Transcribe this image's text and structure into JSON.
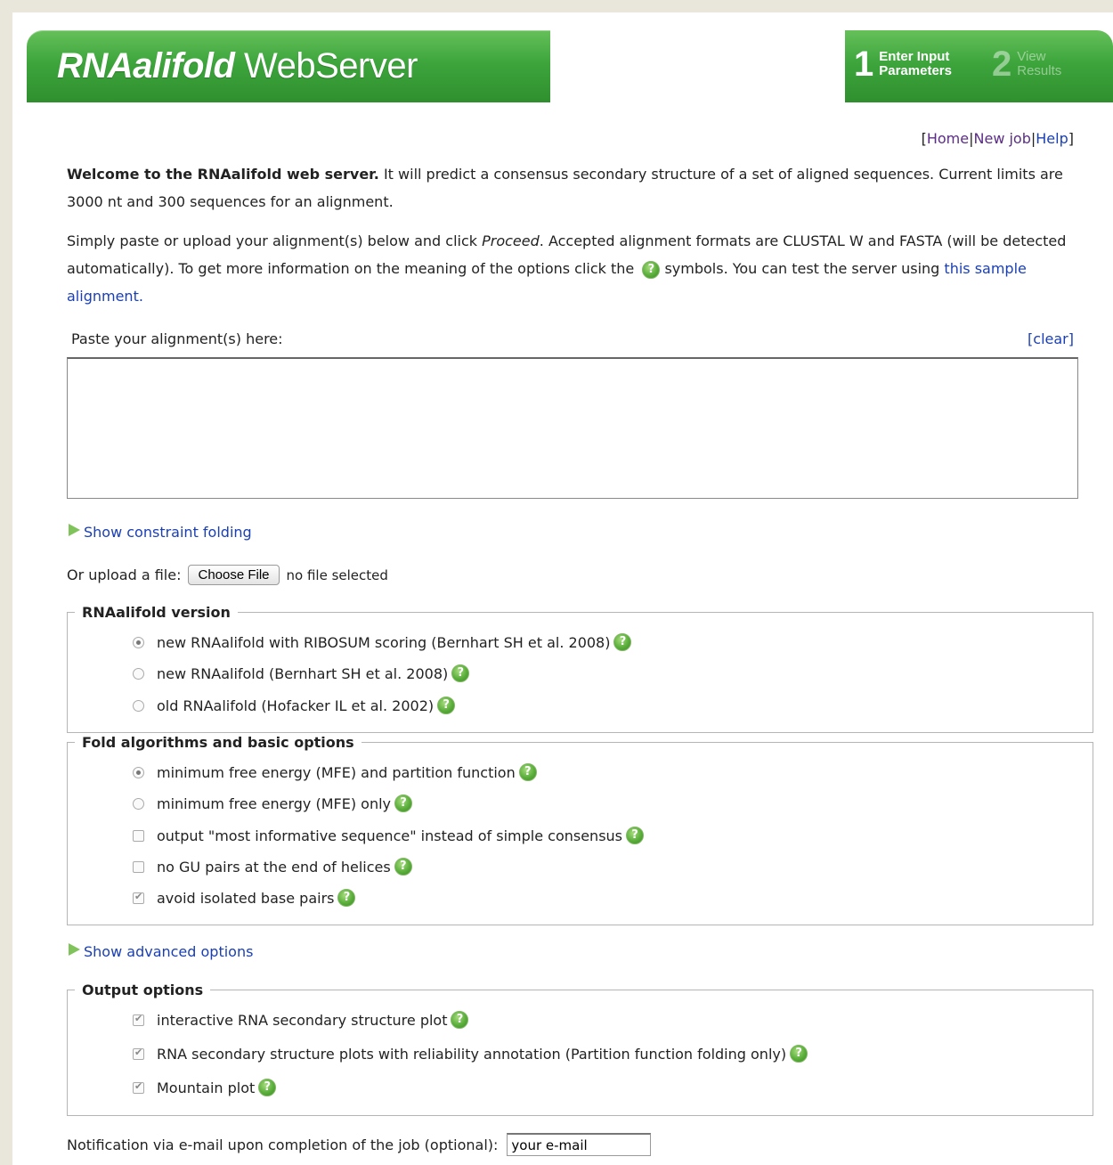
{
  "header": {
    "title_bold": "RNAalifold",
    "title_rest": " WebServer",
    "steps": [
      {
        "num": "1",
        "line1": "Enter Input",
        "line2": "Parameters"
      },
      {
        "num": "2",
        "line1": "View",
        "line2": "Results"
      }
    ]
  },
  "nav": {
    "open": "[",
    "home": "Home",
    "sep1": "|",
    "newjob": "New job",
    "sep2": "|",
    "help": "Help",
    "close": "]"
  },
  "intro": {
    "bold": "Welcome to the RNAalifold web server.",
    "text": " It will predict a consensus secondary structure of a set of aligned sequences. Current limits are 3000 nt and 300 sequences for an alignment."
  },
  "instructions": {
    "part1": "Simply paste or upload your alignment(s) below and click ",
    "proceed": "Proceed",
    "part2": ". Accepted alignment formats are CLUSTAL W and FASTA (will be detected automatically). To get more information on the meaning of the options click the ",
    "part3": " symbols. You can test the server using ",
    "sample_link": "this sample alignment."
  },
  "alignment": {
    "label": "Paste your alignment(s) here:",
    "clear": "[clear]",
    "value": ""
  },
  "constraint_toggle": "Show constraint folding",
  "upload": {
    "label": "Or upload a file:",
    "button": "Choose File",
    "status": "no file selected"
  },
  "version": {
    "legend": "RNAalifold version",
    "options": [
      {
        "label": "new RNAalifold with RIBOSUM scoring (Bernhart SH et al. 2008)",
        "selected": true
      },
      {
        "label": "new RNAalifold (Bernhart SH et al. 2008)",
        "selected": false
      },
      {
        "label": "old RNAalifold (Hofacker IL et al. 2002)",
        "selected": false
      }
    ]
  },
  "fold": {
    "legend": "Fold algorithms and basic options",
    "options": [
      {
        "label": "minimum free energy (MFE) and partition function",
        "type": "radio",
        "checked": true
      },
      {
        "label": "minimum free energy (MFE) only",
        "type": "radio",
        "checked": false
      },
      {
        "label": "output \"most informative sequence\" instead of simple consensus",
        "type": "checkbox",
        "checked": false
      },
      {
        "label": "no GU pairs at the end of helices",
        "type": "checkbox",
        "checked": false
      },
      {
        "label": "avoid isolated base pairs",
        "type": "checkbox",
        "checked": true
      }
    ]
  },
  "advanced_toggle": "Show advanced options",
  "output": {
    "legend": "Output options",
    "options": [
      {
        "label": "interactive RNA secondary structure plot",
        "checked": true
      },
      {
        "label": "RNA secondary structure plots with reliability annotation (Partition function folding only)",
        "checked": true
      },
      {
        "label": "Mountain plot",
        "checked": true
      }
    ]
  },
  "email": {
    "label": "Notification via e-mail upon completion of the job (optional):",
    "value": "your e-mail"
  },
  "help_icon_glyph": "?",
  "colors": {
    "banner_green": "#3da53c",
    "link_blue": "#1a3fb5",
    "visited_purple": "#5b2d86",
    "page_bg": "#e9e6dc"
  }
}
